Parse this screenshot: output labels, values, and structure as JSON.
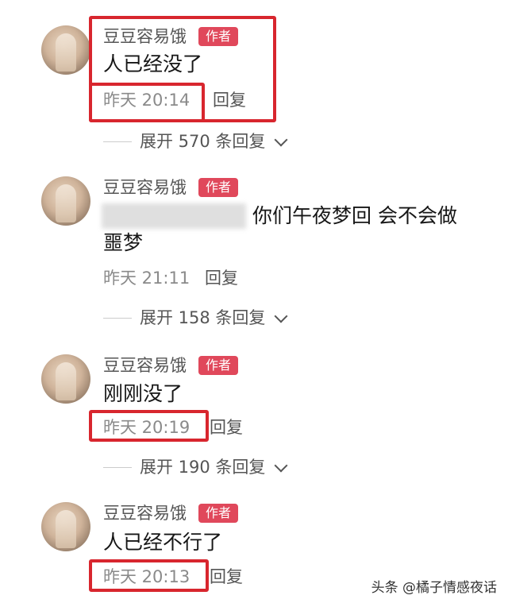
{
  "comments": [
    {
      "name": "豆豆容易饿",
      "badge": "作者",
      "text": "人已经没了",
      "time": "昨天 20:14",
      "reply": "回复",
      "expand": "展开 570 条回复"
    },
    {
      "name": "豆豆容易饿",
      "badge": "作者",
      "text": "你们午夜梦回 会不会做",
      "text2": "噩梦",
      "time": "昨天 21:11",
      "reply": "回复",
      "expand": "展开 158 条回复"
    },
    {
      "name": "豆豆容易饿",
      "badge": "作者",
      "text": "刚刚没了",
      "time": "昨天 20:19",
      "reply": "回复",
      "expand": "展开 190 条回复"
    },
    {
      "name": "豆豆容易饿",
      "badge": "作者",
      "text": "人已经不行了",
      "time": "昨天 20:13",
      "reply": "回复"
    }
  ],
  "watermark": "头条 @橘子情感夜话",
  "colors": {
    "badge": "#e0485b",
    "highlight_box": "#d8262e"
  }
}
